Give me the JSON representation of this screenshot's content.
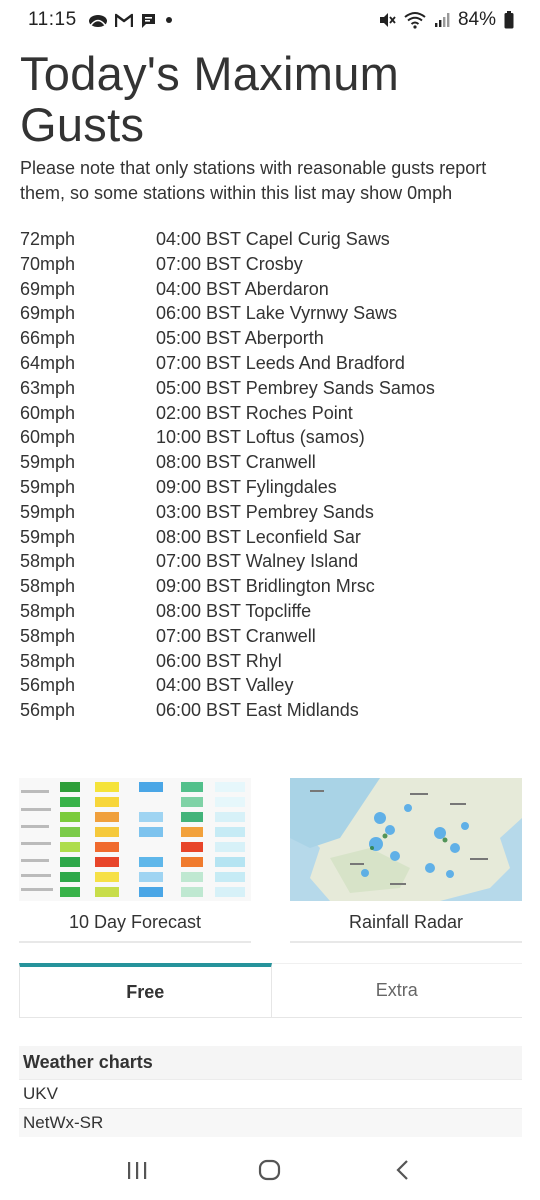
{
  "status_bar": {
    "time": "11:15",
    "battery": "84%",
    "icons": [
      "cloud-icon",
      "gmail-icon",
      "chat-icon",
      "dot-icon",
      "mute-icon",
      "wifi-icon",
      "signal-icon",
      "battery-icon"
    ]
  },
  "page": {
    "title": "Today's Maximum Gusts",
    "note": "Please note that only stations with reasonable gusts report them, so some stations within this list may show 0mph"
  },
  "gusts": [
    {
      "speed": "72mph",
      "time": "04:00 BST",
      "station": "Capel Curig Saws"
    },
    {
      "speed": "70mph",
      "time": "07:00 BST",
      "station": "Crosby"
    },
    {
      "speed": "69mph",
      "time": "04:00 BST",
      "station": "Aberdaron"
    },
    {
      "speed": "69mph",
      "time": "06:00 BST",
      "station": "Lake Vyrnwy Saws"
    },
    {
      "speed": "66mph",
      "time": "05:00 BST",
      "station": "Aberporth"
    },
    {
      "speed": "64mph",
      "time": "07:00 BST",
      "station": "Leeds And Bradford"
    },
    {
      "speed": "63mph",
      "time": "05:00 BST",
      "station": "Pembrey Sands Samos"
    },
    {
      "speed": "60mph",
      "time": "02:00 BST",
      "station": "Roches Point"
    },
    {
      "speed": "60mph",
      "time": "10:00 BST",
      "station": "Loftus (samos)"
    },
    {
      "speed": "59mph",
      "time": "08:00 BST",
      "station": "Cranwell"
    },
    {
      "speed": "59mph",
      "time": "09:00 BST",
      "station": "Fylingdales"
    },
    {
      "speed": "59mph",
      "time": "03:00 BST",
      "station": "Pembrey Sands"
    },
    {
      "speed": "59mph",
      "time": "08:00 BST",
      "station": "Leconfield Sar"
    },
    {
      "speed": "58mph",
      "time": "07:00 BST",
      "station": "Walney Island"
    },
    {
      "speed": "58mph",
      "time": "09:00 BST",
      "station": "Bridlington Mrsc"
    },
    {
      "speed": "58mph",
      "time": "08:00 BST",
      "station": "Topcliffe"
    },
    {
      "speed": "58mph",
      "time": "07:00 BST",
      "station": "Cranwell"
    },
    {
      "speed": "58mph",
      "time": "06:00 BST",
      "station": "Rhyl"
    },
    {
      "speed": "56mph",
      "time": "04:00 BST",
      "station": "Valley"
    },
    {
      "speed": "56mph",
      "time": "06:00 BST",
      "station": "East Midlands"
    }
  ],
  "cards": [
    {
      "label": "10 Day Forecast"
    },
    {
      "label": "Rainfall Radar"
    }
  ],
  "tabs": [
    {
      "label": "Free",
      "active": true
    },
    {
      "label": "Extra",
      "active": false
    }
  ],
  "weather_charts": {
    "header": "Weather charts",
    "items": [
      "UKV",
      "NetWx-SR"
    ]
  },
  "colors": {
    "accent": "#26939b",
    "text": "#333333",
    "header_bg": "#f5f5f5"
  }
}
